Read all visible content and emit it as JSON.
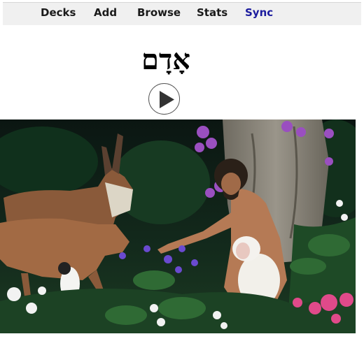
{
  "toolbar": {
    "items": [
      {
        "label": "Decks"
      },
      {
        "label": "Add"
      },
      {
        "label": "Browse"
      },
      {
        "label": "Stats"
      },
      {
        "label": "Sync"
      }
    ],
    "sync_color": "#1b1b9e"
  },
  "card": {
    "word": "אָדָם",
    "play_icon": "play-circle-icon",
    "image_subject": "garden-scene-image"
  }
}
